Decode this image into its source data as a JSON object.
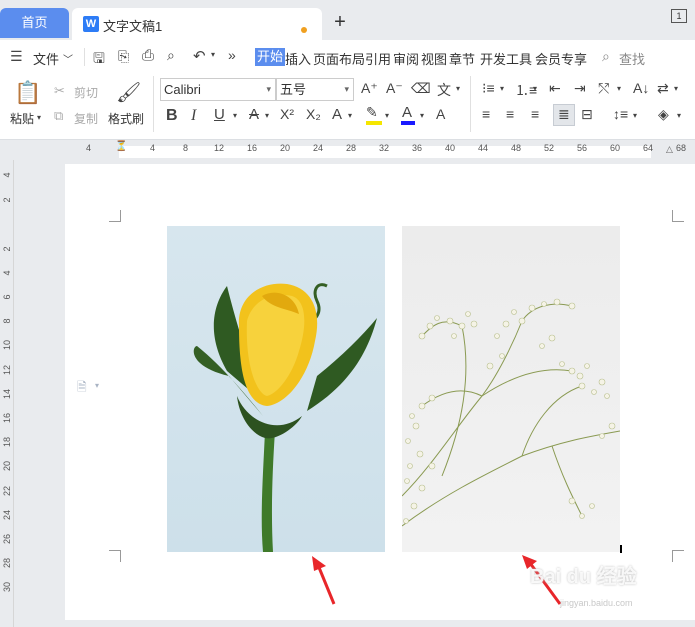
{
  "tabs": {
    "home": "首页",
    "doc_title": "文字文稿1",
    "add": "+",
    "window_badge": "1"
  },
  "menu": {
    "file": "文件",
    "items": [
      "开始",
      "插入",
      "页面布局",
      "引用",
      "审阅",
      "视图",
      "章节",
      "开发工具",
      "会员专享"
    ],
    "active": "开始",
    "search": "查找"
  },
  "ribbon": {
    "paste": "粘贴",
    "cut": "剪切",
    "copy": "复制",
    "format_painter": "格式刷",
    "font_name": "Calibri",
    "font_size": "五号"
  },
  "ruler": {
    "h_ticks": [
      "4",
      "4",
      "8",
      "12",
      "16",
      "20",
      "24",
      "28",
      "32",
      "36",
      "40",
      "44",
      "48",
      "52",
      "56",
      "60",
      "64",
      "68"
    ],
    "v_ticks": [
      "4",
      "2",
      "2",
      "4",
      "6",
      "8",
      "10",
      "12",
      "14",
      "16",
      "18",
      "20",
      "22",
      "24",
      "26",
      "28",
      "30"
    ]
  },
  "watermark": {
    "text": "Bai du 经验",
    "sub": "jingyan.baidu.com"
  },
  "colors": {
    "accent": "#5b8dee",
    "highlight": "#f5e600",
    "font_color": "#1a1aff",
    "arrow": "#e8262a"
  }
}
